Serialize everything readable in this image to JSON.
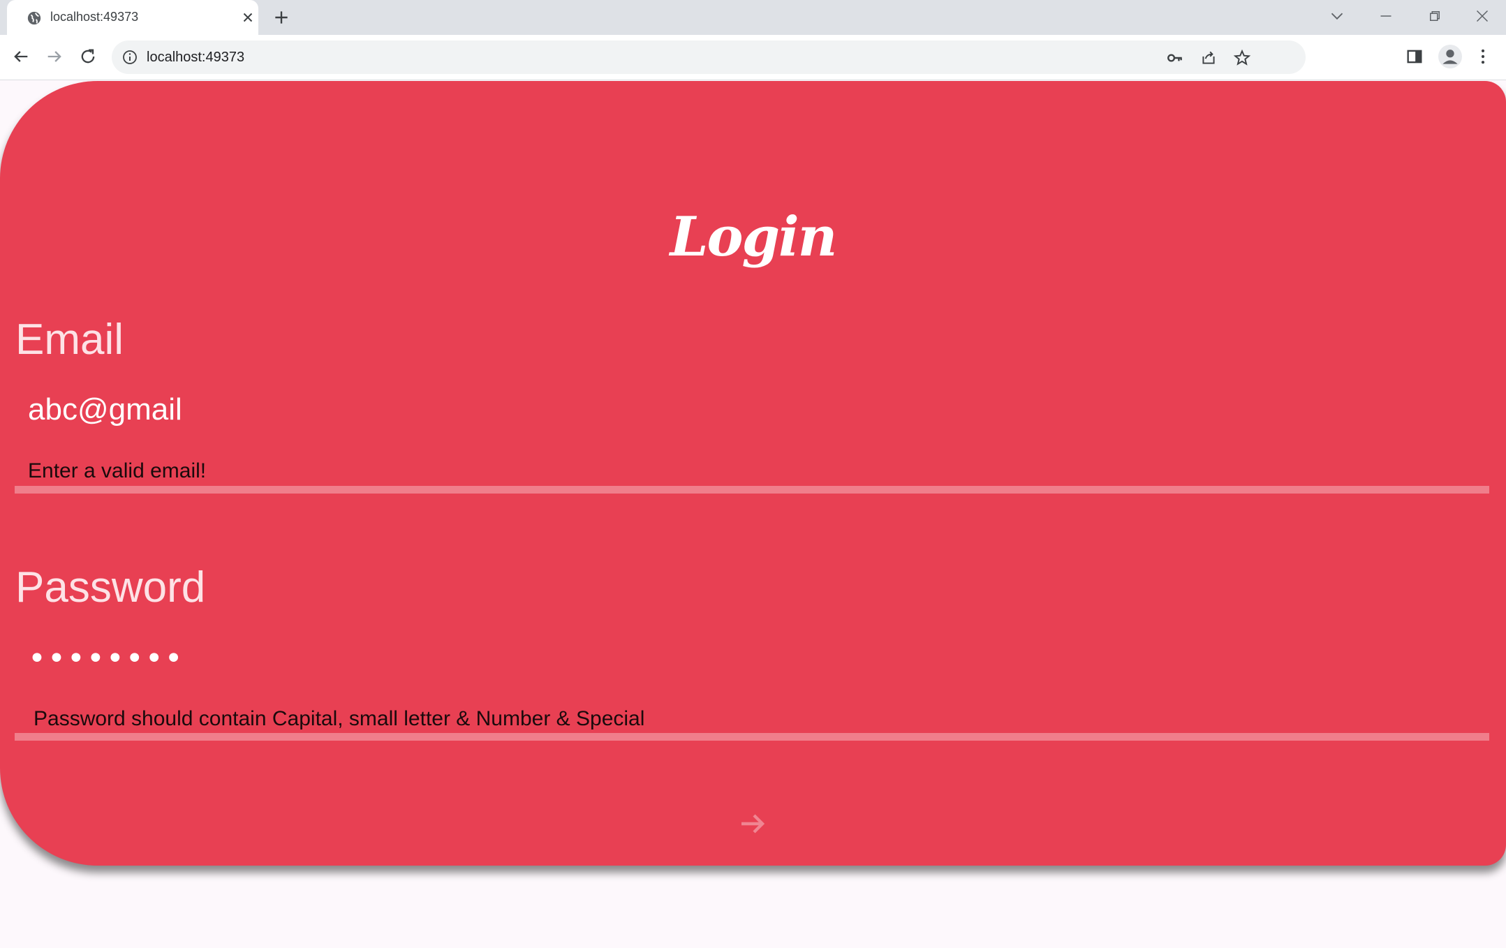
{
  "browser": {
    "tab_title": "localhost:49373",
    "url": "localhost:49373"
  },
  "login": {
    "title": "Login",
    "email": {
      "label": "Email",
      "value": "abc@gmail",
      "error": "Enter a valid email!"
    },
    "password": {
      "label": "Password",
      "masked_value": "••••••••",
      "error": "Password should contain Capital, small letter & Number & Special"
    },
    "submit_icon": "arrow-right-icon"
  },
  "colors": {
    "card_background": "#e84053",
    "underline": "#f07e8b",
    "page_background": "#fdf8fc"
  }
}
